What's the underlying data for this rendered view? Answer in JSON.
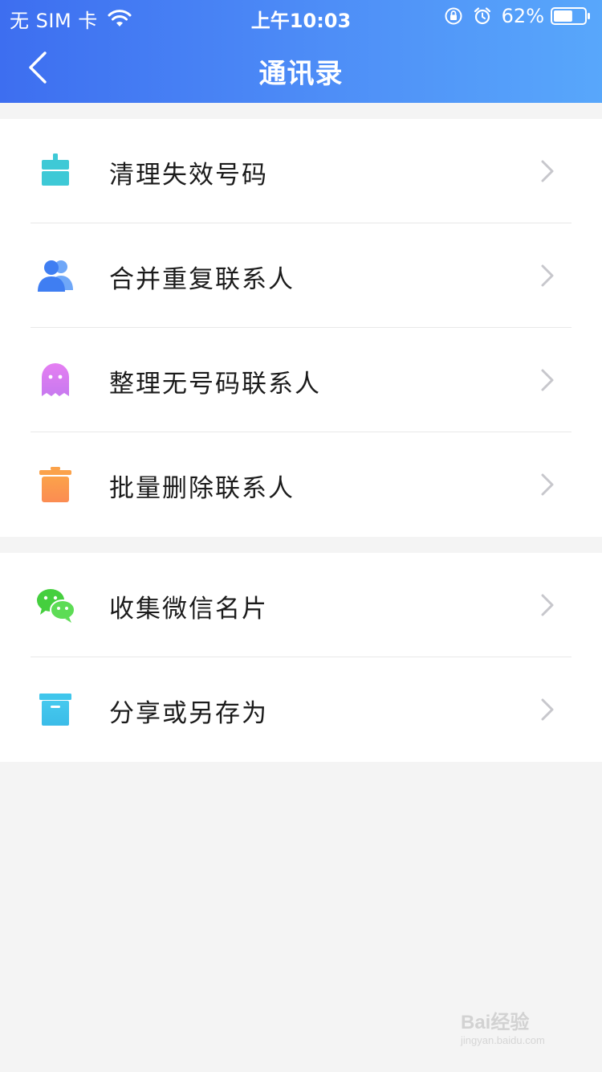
{
  "status_bar": {
    "carrier": "无 SIM 卡",
    "time": "上午10:03",
    "battery_percent": "62%",
    "battery_level": 0.62
  },
  "navbar": {
    "title": "通讯录",
    "back_icon": "chevron-left-icon"
  },
  "groups": [
    {
      "items": [
        {
          "label": "清理失效号码",
          "icon": "broom-basket-icon",
          "color": "#3ec9d6"
        },
        {
          "label": "合并重复联系人",
          "icon": "contacts-merge-icon",
          "color": "#3f7ef2"
        },
        {
          "label": "整理无号码联系人",
          "icon": "ghost-icon",
          "color": "#d77cf0"
        },
        {
          "label": "批量删除联系人",
          "icon": "trash-icon",
          "color": "#fb9b4a"
        }
      ]
    },
    {
      "items": [
        {
          "label": "收集微信名片",
          "icon": "wechat-icon",
          "color": "#45cf3e"
        },
        {
          "label": "分享或另存为",
          "icon": "archive-box-icon",
          "color": "#3fc6ec"
        }
      ]
    }
  ],
  "watermark": {
    "brand": "Bai经验",
    "url": "jingyan.baidu.com"
  },
  "colors": {
    "header_start": "#3d6ef0",
    "header_end": "#58a7fb",
    "background": "#f4f4f4",
    "chevron": "#c7c7cc"
  }
}
